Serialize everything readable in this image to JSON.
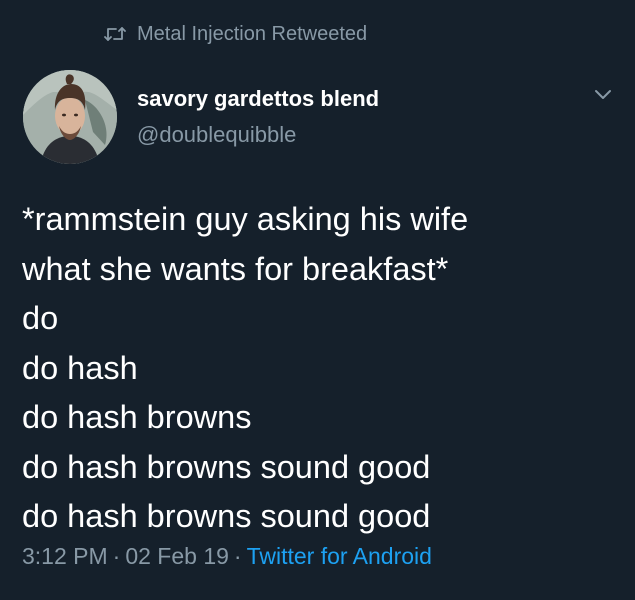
{
  "retweet_banner": {
    "icon": "retweet-icon",
    "text": "Metal Injection Retweeted"
  },
  "author": {
    "display_name": "savory gardettos blend",
    "handle": "@doublequibble",
    "avatar": "user-avatar"
  },
  "menu": {
    "icon": "chevron-down-icon"
  },
  "tweet": {
    "lines": [
      "*rammstein guy asking his wife",
      "what she wants for breakfast*",
      "do",
      "do hash",
      "do hash browns",
      "do hash browns sound good",
      "do hash browns sound good"
    ]
  },
  "meta": {
    "time": "3:12 PM",
    "separator": "·",
    "date": "02 Feb 19",
    "source": "Twitter for Android"
  },
  "colors": {
    "background": "#15202b",
    "text": "#ffffff",
    "muted": "#8899a6",
    "link": "#1da1f2"
  }
}
